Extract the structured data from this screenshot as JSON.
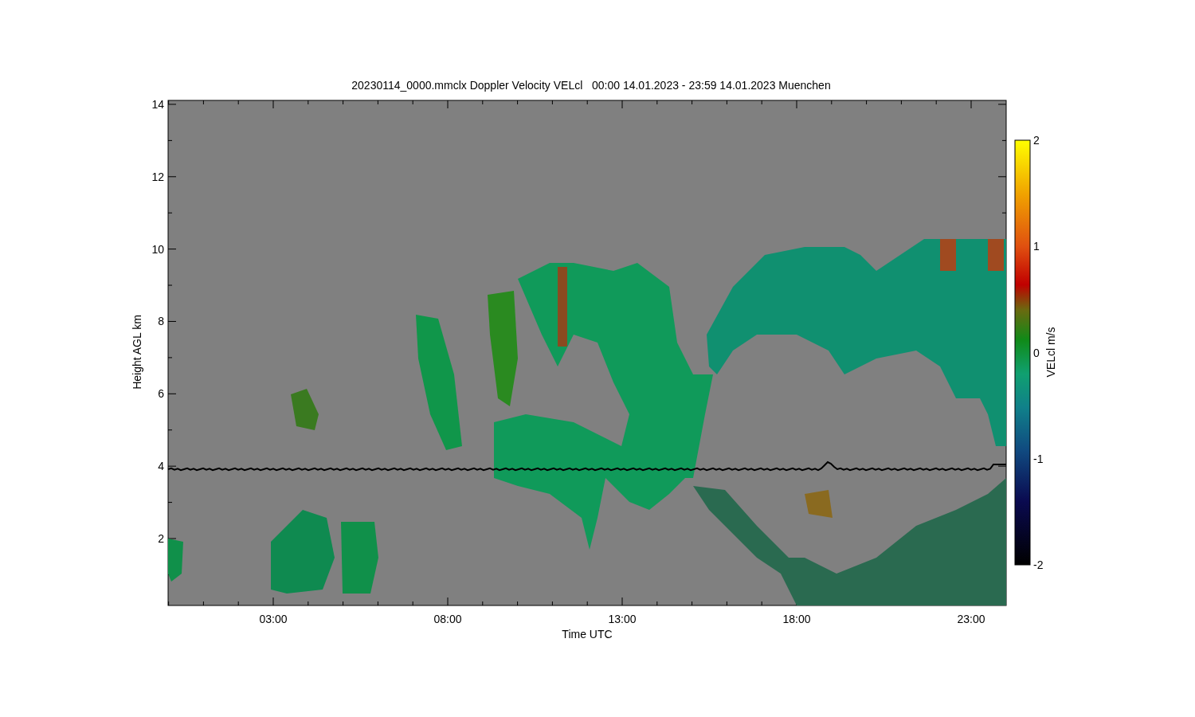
{
  "title": "20230114_0000.mmclx Doppler Velocity VELcl   00:00 14.01.2023 - 23:59 14.01.2023 Muenchen",
  "y_axis": {
    "label": "Height AGL km",
    "ticks": [
      "14",
      "12",
      "10",
      "8",
      "6",
      "4",
      "2"
    ]
  },
  "x_axis": {
    "label": "Time UTC",
    "ticks": [
      "03:00",
      "08:00",
      "13:00",
      "18:00",
      "23:00"
    ]
  },
  "colorbar": {
    "label": "VELcl m/s",
    "ticks": [
      "2",
      "1",
      "0",
      "-1",
      "-2"
    ]
  }
}
